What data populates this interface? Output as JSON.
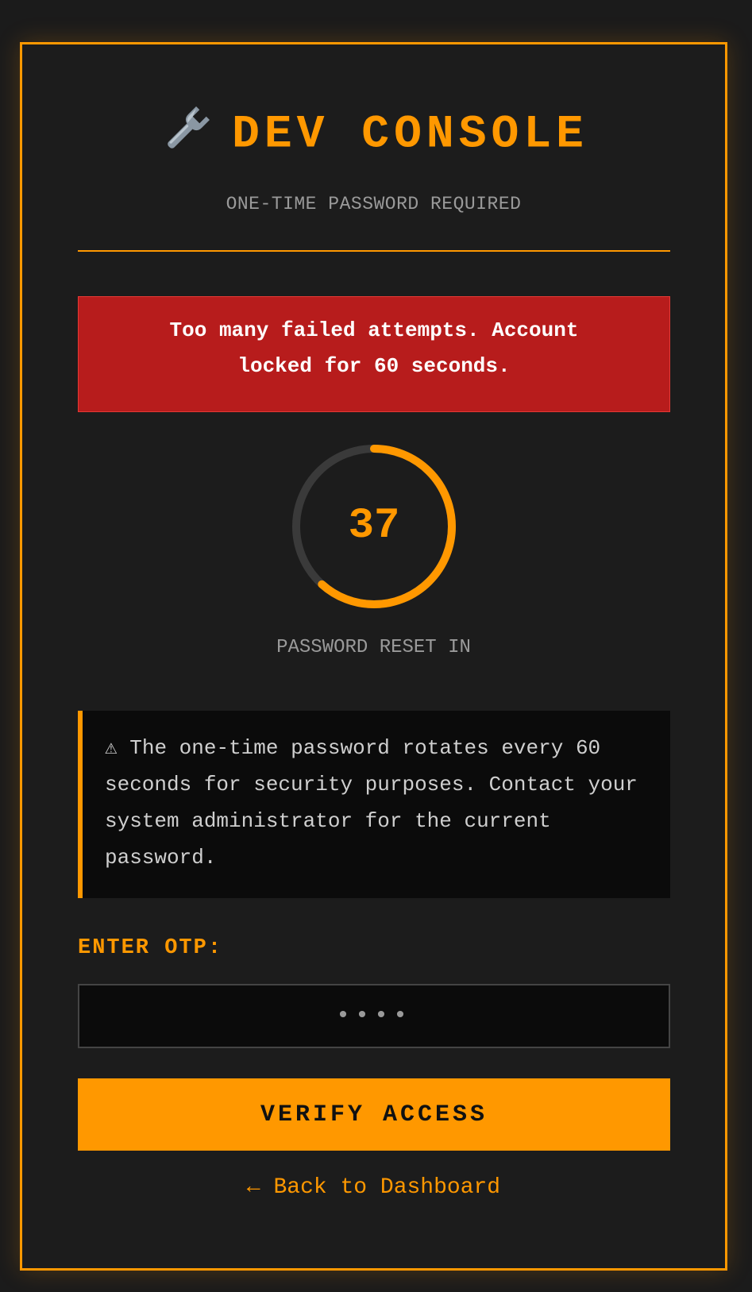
{
  "header": {
    "icon": "wrench-icon",
    "title": "DEV CONSOLE",
    "subtitle": "ONE-TIME PASSWORD REQUIRED"
  },
  "alert": {
    "message": "Too many failed attempts. Account locked for 60 seconds."
  },
  "countdown": {
    "value": "37",
    "total_seconds": 60,
    "remaining_seconds": 37,
    "label": "PASSWORD RESET IN"
  },
  "notice": {
    "icon": "warning-icon",
    "text": "⚠ The one-time password rotates every 60 seconds for security purposes. Contact your system administrator for the current password."
  },
  "form": {
    "otp_label": "ENTER OTP:",
    "otp_placeholder": "••••",
    "verify_label": "VERIFY ACCESS"
  },
  "footer": {
    "back_label": "← Back to Dashboard"
  },
  "colors": {
    "accent": "#ff9800",
    "alert_bg": "#b71c1c",
    "background": "#1c1c1c"
  }
}
